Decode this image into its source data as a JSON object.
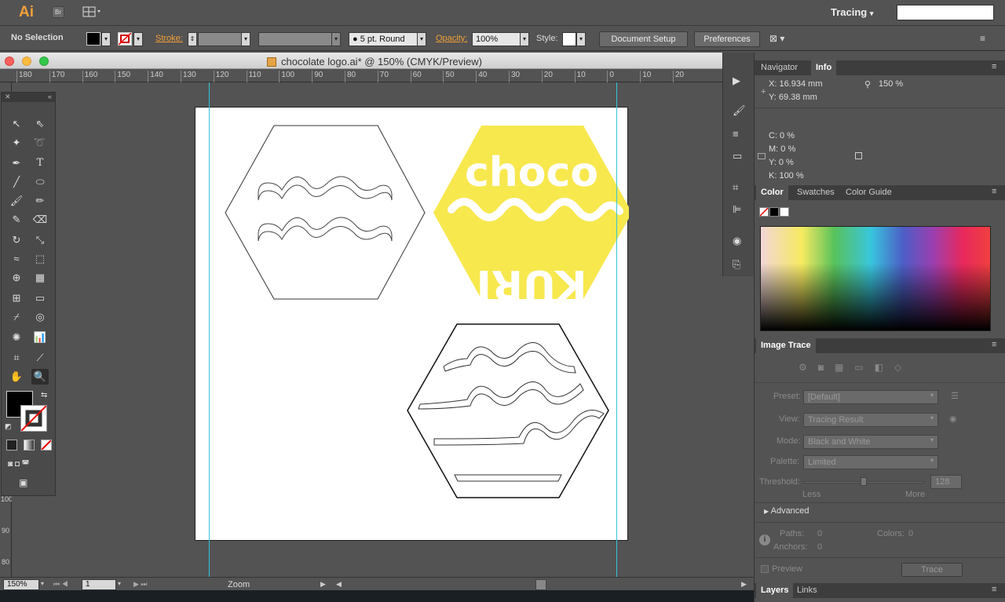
{
  "app": {
    "logo": "Ai",
    "bridge": "Br",
    "workspace": "Tracing",
    "workspace_chevron": "▾"
  },
  "control": {
    "selection": "No Selection",
    "stroke_label": "Stroke:",
    "brush": "5 pt. Round",
    "opacity_label": "Opacity:",
    "opacity_value": "100%",
    "style_label": "Style:",
    "doc_setup": "Document Setup",
    "preferences": "Preferences"
  },
  "document": {
    "title": "chocolate logo.ai* @ 150% (CMYK/Preview)"
  },
  "ruler": {
    "labels": [
      "180",
      "170",
      "160",
      "150",
      "140",
      "130",
      "120",
      "110",
      "100",
      "90",
      "80",
      "70",
      "60",
      "50",
      "40",
      "30",
      "20",
      "10",
      "0",
      "10",
      "20"
    ],
    "v_labels": [
      "100",
      "90",
      "80"
    ]
  },
  "artwork": {
    "logo_top": "choco",
    "logo_bottom": "KURI"
  },
  "status": {
    "zoom": "150%",
    "page": "1",
    "mode": "Zoom"
  },
  "info_panel": {
    "tabs": [
      "Navigator",
      "Info"
    ],
    "x": "X:  16.934 mm",
    "y": "Y:  69.38 mm",
    "zoom": "150 %",
    "c": "C:  0 %",
    "m": "M:  0 %",
    "yv": "Y:  0 %",
    "k": "K:  100 %"
  },
  "color_panel": {
    "tabs": [
      "Color",
      "Swatches",
      "Color Guide"
    ]
  },
  "image_trace": {
    "title": "Image Trace",
    "preset_label": "Preset:",
    "preset": "[Default]",
    "view_label": "View:",
    "view": "Tracing Result",
    "mode_label": "Mode:",
    "mode": "Black and White",
    "palette_label": "Palette:",
    "palette": "Limited",
    "threshold_label": "Threshold:",
    "threshold": "128",
    "threshold_level": 0.5,
    "less": "Less",
    "more": "More",
    "advanced": "Advanced",
    "paths": "Paths:",
    "paths_v": "0",
    "anchors": "Anchors:",
    "anchors_v": "0",
    "colors": "Colors:",
    "colors_v": "0",
    "preview": "Preview",
    "trace": "Trace"
  },
  "layers_panel": {
    "tabs": [
      "Layers",
      "Links"
    ]
  },
  "colors": {
    "accent": "#f29f38",
    "logo_yellow": "#f7e84e",
    "guide": "#37c4d8"
  }
}
